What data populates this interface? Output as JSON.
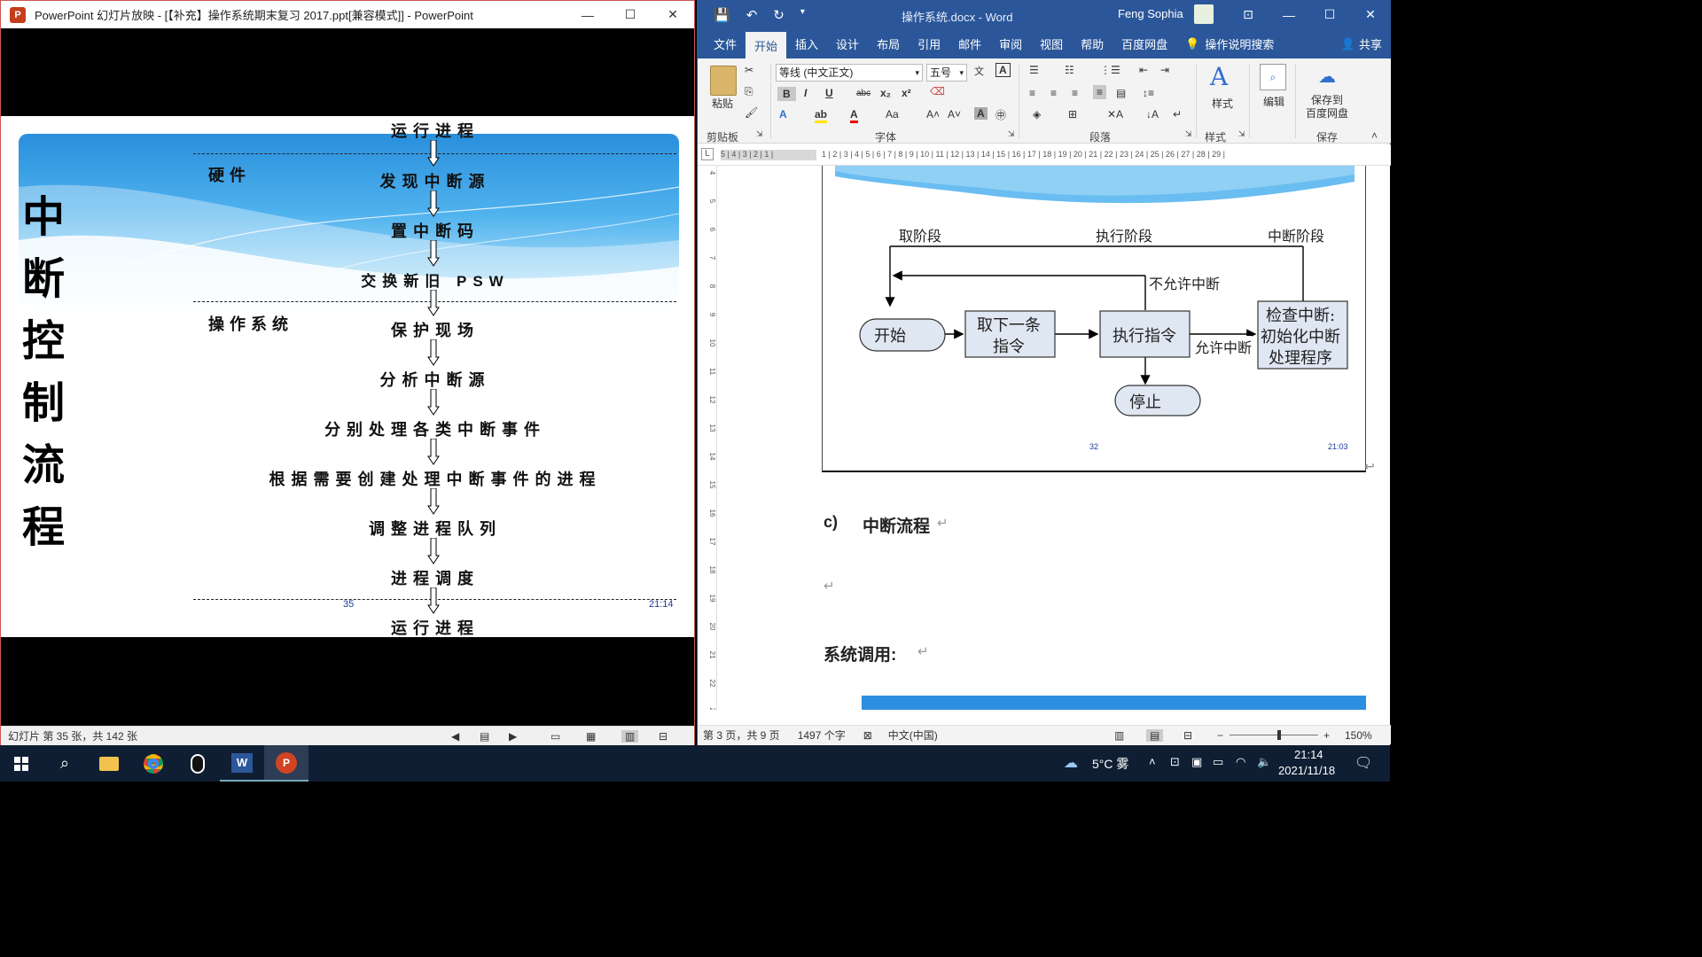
{
  "ppt": {
    "title": "PowerPoint 幻灯片放映 - [【补充】操作系统期末复习 2017.ppt[兼容模式]] - PowerPoint",
    "slide": {
      "vertical_title": [
        "中",
        "断",
        "控",
        "制",
        "流",
        "程"
      ],
      "side_hardware": "硬件",
      "side_os": "操作系统",
      "steps": [
        "运行进程",
        "发现中断源",
        "置中断码",
        "交换新旧 PSW",
        "保护现场",
        "分析中断源",
        "分别处理各类中断事件",
        "根据需要创建处理中断事件的进程",
        "调整进程队列",
        "进程调度",
        "运行进程"
      ],
      "page_number": "35",
      "time": "21:14"
    },
    "status": "幻灯片 第 35 张，共 142 张"
  },
  "word": {
    "doc_title": "操作系统.docx  -  Word",
    "user": "Feng Sophia",
    "tabs": [
      "文件",
      "开始",
      "插入",
      "设计",
      "布局",
      "引用",
      "邮件",
      "审阅",
      "视图",
      "帮助",
      "百度网盘",
      "操作说明搜索",
      "共享"
    ],
    "active_tab": "开始",
    "ribbon": {
      "paste": "粘贴",
      "clipboard": "剪贴板",
      "font_name": "等线 (中文正文)",
      "font_size": "五号",
      "font_group": "字体",
      "paragraph_group": "段落",
      "styles": "样式",
      "styles_group": "样式",
      "edit": "编辑",
      "save_baidu": "保存到\n百度网盘",
      "save_group": "保存"
    },
    "ruler_left": "5 | 4 | 3 | 2 | 1 |",
    "ruler_right": "1 | 2 | 3 | 4 | 5 | 6 | 7 | 8 | 9 | 10 | 11 | 12 | 13 | 14 | 15 | 16 | 17 | 18 | 19 | 20 | 21 | 22 | 23 | 24 | 25 | 26 | 27 | 28 | 29 |",
    "vruler": [
      "4",
      "5",
      "6",
      "7",
      "8",
      "9",
      "10",
      "11",
      "12",
      "13",
      "14",
      "15",
      "16",
      "17",
      "18",
      "19",
      "20",
      "21",
      "22",
      "23"
    ],
    "diagram": {
      "phase_fetch": "取阶段",
      "phase_exec": "执行阶段",
      "phase_int": "中断阶段",
      "no_int": "不允许中断",
      "allow_int": "允许中断",
      "start": "开始",
      "fetch_1": "取下一条",
      "fetch_2": "指令",
      "exec": "执行指令",
      "check_1": "检查中断:",
      "check_2": "初始化中断",
      "check_3": "处理程序",
      "stop": "停止",
      "page_num": "32",
      "time": "21:03"
    },
    "heading_c": "c)",
    "heading_c_text": "中断流程",
    "syscall": "系统调用:",
    "status": {
      "page": "第 3 页，共 9 页",
      "words": "1497 个字",
      "lang": "中文(中国)",
      "zoom": "150%"
    }
  },
  "taskbar": {
    "weather": "5°C 雾",
    "time": "21:14",
    "date": "2021/11/18"
  }
}
